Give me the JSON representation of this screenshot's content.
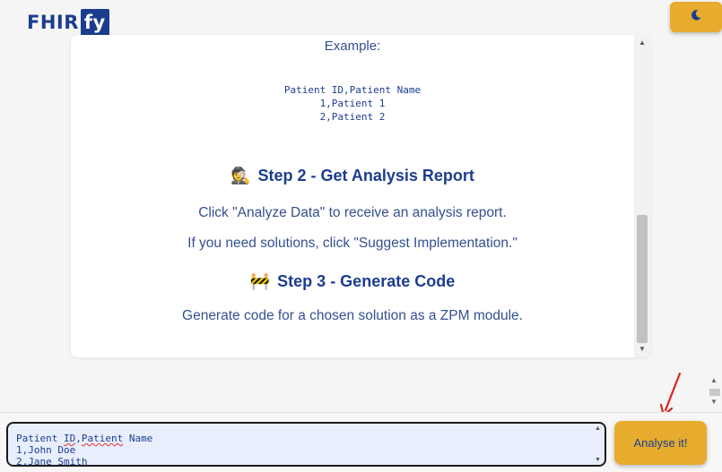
{
  "header": {
    "logo_main": "FHIR",
    "logo_badge": "fy"
  },
  "theme_toggle": {
    "icon": "moon-icon"
  },
  "card": {
    "example_label": "Example:",
    "code_lines": [
      "Patient ID,Patient Name",
      "1,Patient 1",
      "2,Patient 2"
    ],
    "step2": {
      "emoji": "🕵️",
      "title": "Step 2 - Get Analysis Report",
      "text1": "Click \"Analyze Data\" to receive an analysis report.",
      "text2": "If you need solutions, click \"Suggest Implementation.\""
    },
    "step3": {
      "emoji": "🚧",
      "title": "Step 3 - Generate Code",
      "text": "Generate code for a chosen solution as a ZPM module."
    }
  },
  "input": {
    "line1_a": "Patient ",
    "line1_b": "ID",
    "line1_c": ",",
    "line1_d": "Patient",
    "line1_e": " Name",
    "line2": "1,John Doe",
    "line3": "2,Jane Smith"
  },
  "analyse_button": {
    "label": "Analyse it!"
  },
  "colors": {
    "brand": "#1c3d8f",
    "accent": "#e7ac2e",
    "input_bg": "#e8eefc"
  }
}
